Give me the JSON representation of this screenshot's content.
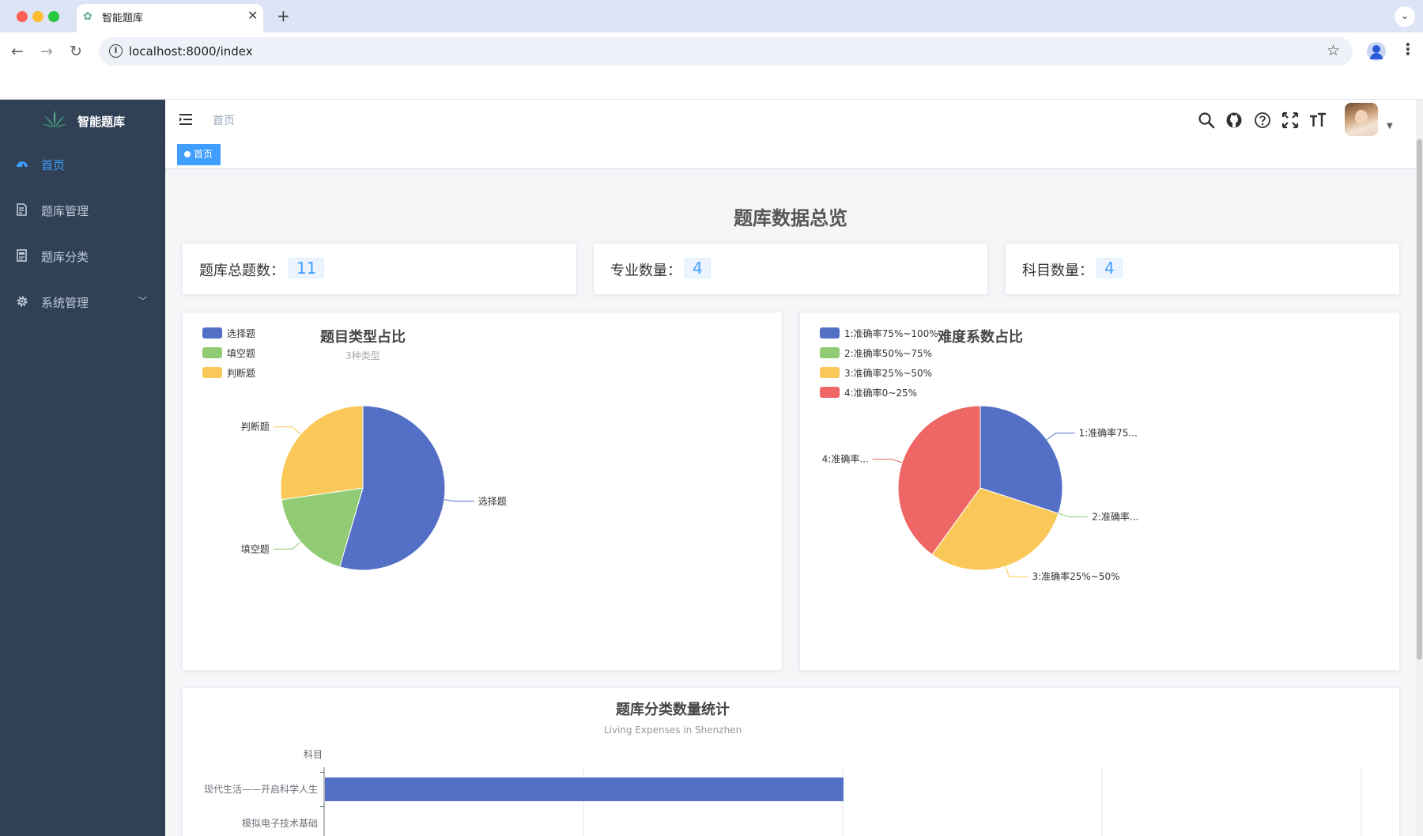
{
  "browser": {
    "tab_title": "智能题库",
    "tab_close": "✕",
    "new_tab": "+",
    "url": "localhost:8000/index",
    "colors": {
      "close": "#ff5f57",
      "minimize": "#febc2e",
      "zoom": "#28c840"
    }
  },
  "sidebar": {
    "app_title": "智能题库",
    "items": [
      {
        "label": "首页",
        "icon": "dashboard-icon",
        "active": true
      },
      {
        "label": "题库管理",
        "icon": "document-edit-icon"
      },
      {
        "label": "题库分类",
        "icon": "category-icon"
      },
      {
        "label": "系统管理",
        "icon": "gear-icon",
        "expandable": true
      }
    ]
  },
  "header": {
    "breadcrumb": "首页",
    "icons": [
      "search-icon",
      "github-icon",
      "help-icon",
      "fullscreen-icon",
      "font-size-icon"
    ]
  },
  "tags": {
    "active": "首页"
  },
  "dashboard": {
    "title": "题库数据总览",
    "stats": [
      {
        "label": "题库总题数：",
        "value": "11"
      },
      {
        "label": "专业数量：",
        "value": "4"
      },
      {
        "label": "科目数量：",
        "value": "4"
      }
    ]
  },
  "chart_data": [
    {
      "type": "pie",
      "title": "题目类型占比",
      "subtitle": "3种类型",
      "legend_position": "top-left",
      "slices": [
        {
          "name": "选择题",
          "value": 6,
          "color": "#5470c6"
        },
        {
          "name": "填空题",
          "value": 2,
          "color": "#91cc75"
        },
        {
          "name": "判断题",
          "value": 3,
          "color": "#fac858"
        }
      ]
    },
    {
      "type": "pie",
      "title": "难度系数占比",
      "legend_position": "top-left",
      "slices": [
        {
          "name": "1:准确率75%~100%",
          "label": "1:准确率75...",
          "value": 3,
          "color": "#5470c6"
        },
        {
          "name": "2:准确率50%~75%",
          "label": "2:准确率...",
          "value": 0,
          "color": "#91cc75"
        },
        {
          "name": "3:准确率25%~50%",
          "label": "3:准确率25%~50%",
          "value": 3,
          "color": "#fac858"
        },
        {
          "name": "4:准确率0~25%",
          "label": "4:准确率...",
          "value": 4,
          "color": "#ee6666"
        }
      ]
    },
    {
      "type": "bar",
      "orientation": "horizontal",
      "title": "题库分类数量统计",
      "subtitle": "Living Expenses in Shenzhen",
      "ylabel": "科目",
      "categories": [
        "现代生活——开启科学人生",
        "模拟电子技术基础"
      ],
      "values": [
        2,
        0
      ],
      "xlim": [
        0,
        4
      ],
      "color": "#5470c6"
    }
  ]
}
